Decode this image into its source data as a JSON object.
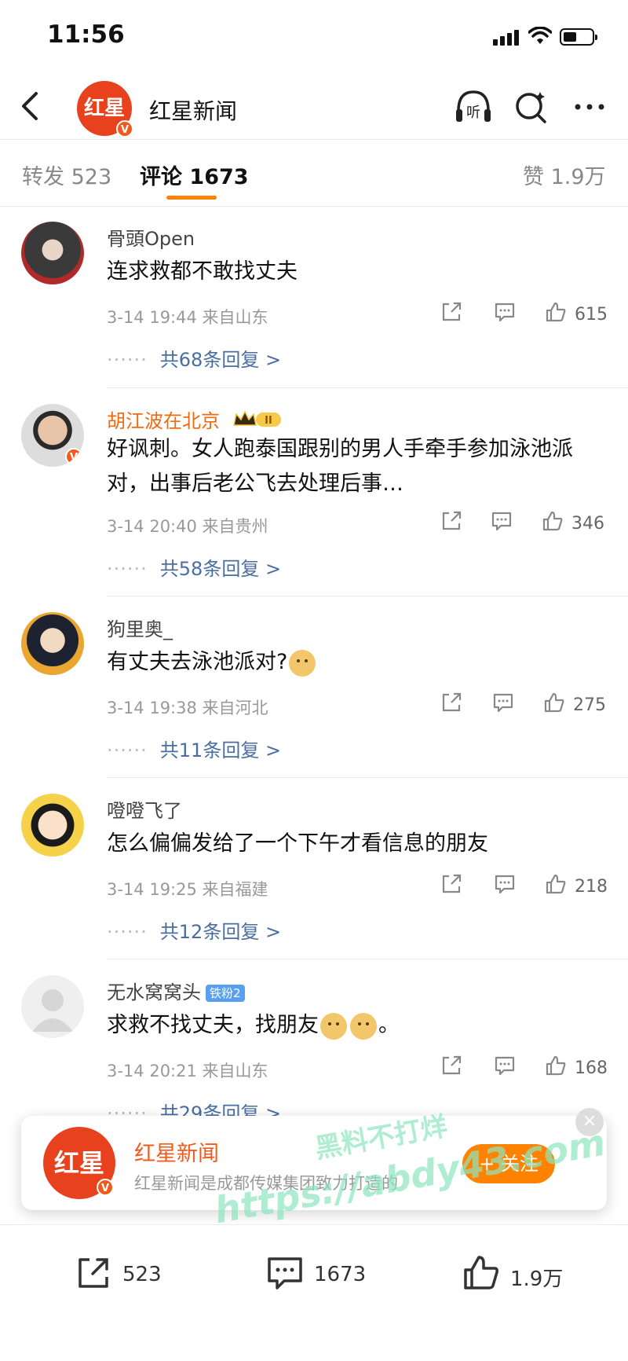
{
  "status_bar": {
    "time": "11:56"
  },
  "header": {
    "avatar_text": "红星",
    "title": "红星新闻",
    "listen_label": "听"
  },
  "tabs": {
    "repost_label": "转发",
    "repost_count": "523",
    "comment_label": "评论",
    "comment_count": "1673",
    "like_label": "赞",
    "like_count": "1.9万"
  },
  "comments": [
    {
      "name": "骨頭Open",
      "text": "连求救都不敢找丈夫",
      "time": "3-14 19:44",
      "location": "来自山东",
      "likes": "615",
      "replies": "共68条回复 >"
    },
    {
      "name": "胡江波在北京",
      "text": "好讽刺。女人跑泰国跟别的男人手牵手参加泳池派对，出事后老公飞去处理后事…",
      "time": "3-14 20:40",
      "location": "来自贵州",
      "likes": "346",
      "replies": "共58条回复 >",
      "medal": "II"
    },
    {
      "name": "狗里奥_",
      "text": "有丈夫去泳池派对?",
      "time": "3-14 19:38",
      "location": "来自河北",
      "likes": "275",
      "replies": "共11条回复 >"
    },
    {
      "name": "噔噔飞了",
      "text": "怎么偏偏发给了一个下午才看信息的朋友",
      "time": "3-14 19:25",
      "location": "来自福建",
      "likes": "218",
      "replies": "共12条回复 >"
    },
    {
      "name": "无水窝窝头",
      "text": "求救不找丈夫，找朋友",
      "text_end": "。",
      "time": "3-14 20:21",
      "location": "来自山东",
      "likes": "168",
      "replies": "共29条回复 >",
      "fan_badge": "铁粉2"
    }
  ],
  "popup": {
    "logo_text": "红星",
    "name": "红星新闻",
    "desc": "红星新闻是成都传媒集团致力打造的",
    "follow_label": "+ 关注",
    "close": "×"
  },
  "bottom_bar": {
    "repost": "523",
    "comment": "1673",
    "like": "1.9万"
  },
  "watermark": {
    "line1": "黑料不打烊",
    "line2": "https://abdy43.com"
  }
}
